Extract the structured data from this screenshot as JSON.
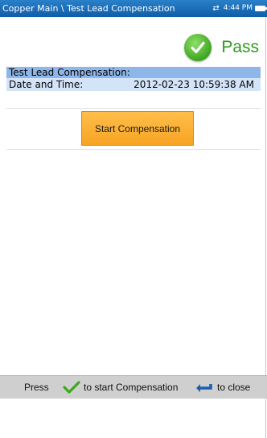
{
  "title_bar": {
    "breadcrumb": "Copper Main \\ Test Lead Compensation",
    "time": "4:44 PM",
    "icons": [
      "sync-icon",
      "battery-icon"
    ]
  },
  "result": {
    "label": "Pass",
    "icon": "check-circle-icon",
    "color": "#2e9a1c"
  },
  "info": {
    "heading": "Test Lead Compensation:",
    "date_label": "Date and Time:",
    "date_value": "2012-02-23 10:59:38 AM"
  },
  "action": {
    "start_label": "Start Compensation",
    "color": "#f7a423"
  },
  "footer": {
    "press": "Press",
    "start_hint": "to start Compensation",
    "close_hint": "to close",
    "icons": [
      "checkmark-icon",
      "back-arrow-icon"
    ]
  },
  "colors": {
    "title_bar": "#1a6fb8",
    "row_highlight": "#8eb6e8",
    "row_light": "#d4e4f8"
  }
}
